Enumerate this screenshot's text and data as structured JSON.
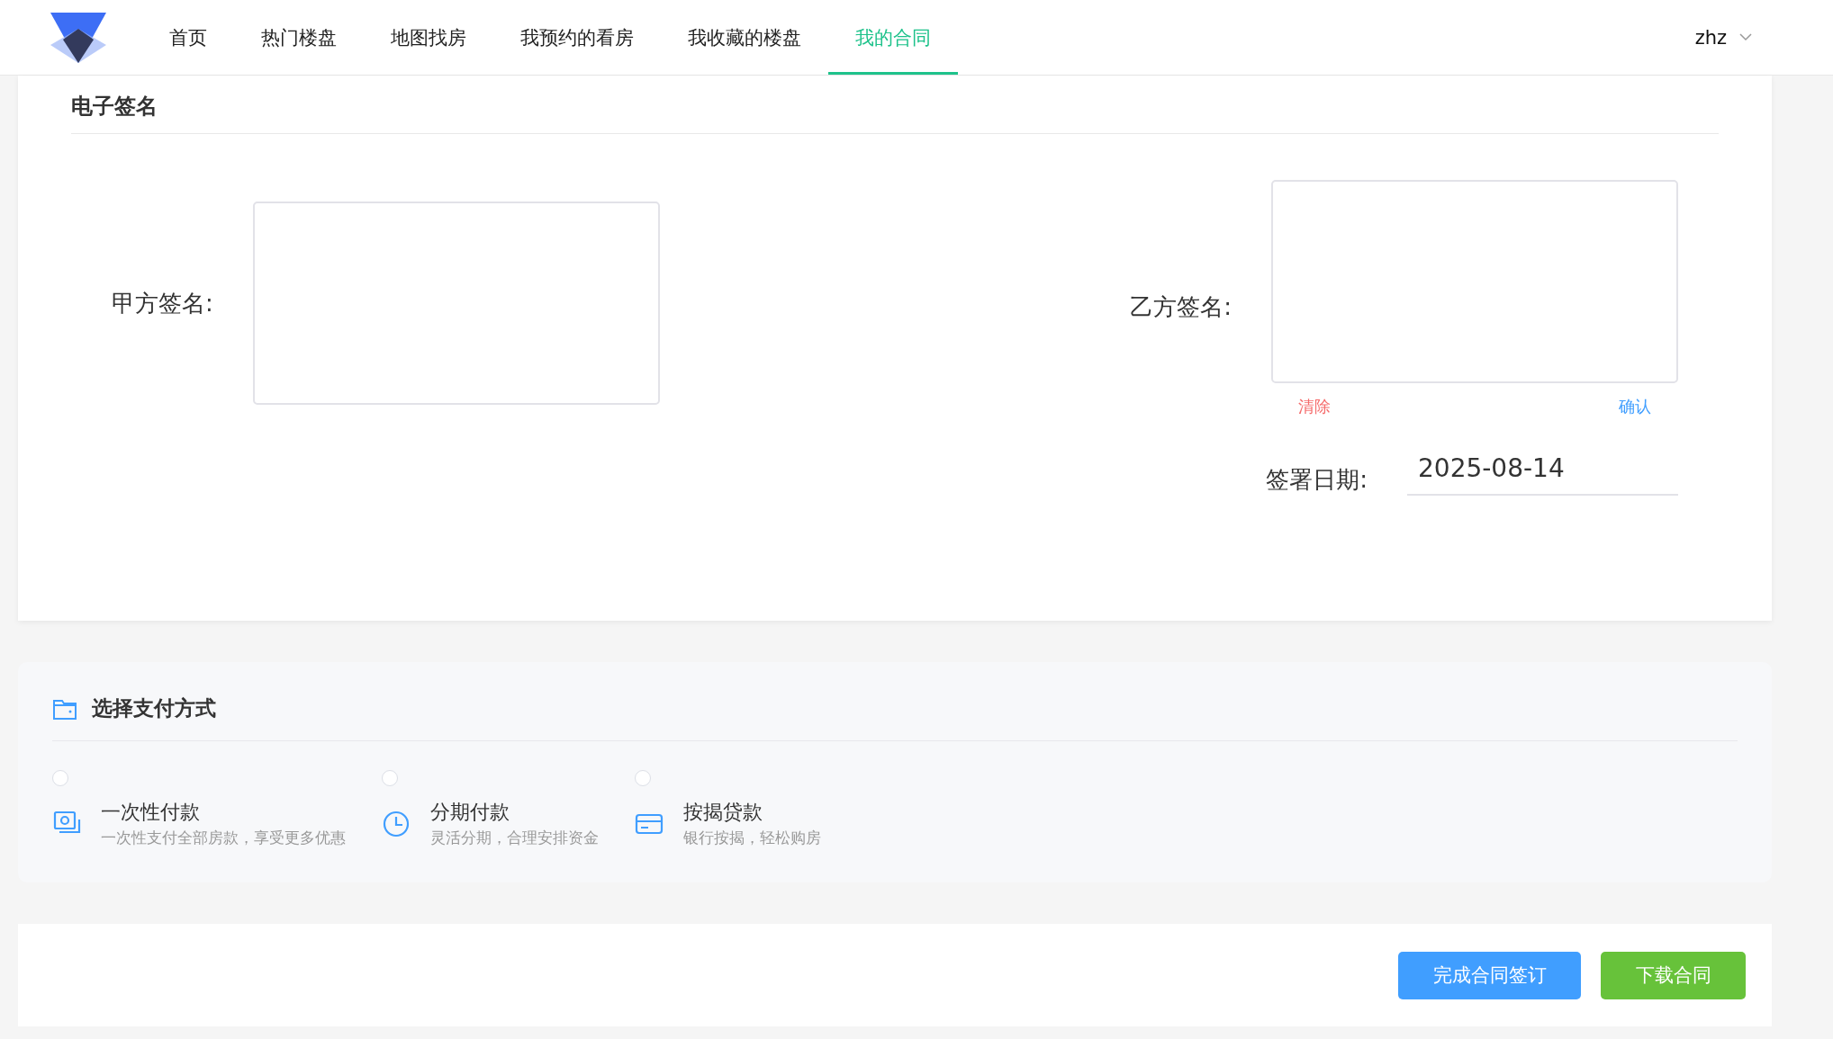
{
  "nav": {
    "items": [
      {
        "label": "首页",
        "selected": false
      },
      {
        "label": "热门楼盘",
        "selected": false
      },
      {
        "label": "地图找房",
        "selected": false
      },
      {
        "label": "我预约的看房",
        "selected": false
      },
      {
        "label": "我收藏的楼盘",
        "selected": false
      },
      {
        "label": "我的合同",
        "selected": true
      }
    ],
    "user": "zhz"
  },
  "signature": {
    "title": "电子签名",
    "party_a_label": "甲方签名:",
    "party_b_label": "乙方签名:",
    "clear": "清除",
    "confirm": "确认",
    "date_label": "签署日期:",
    "date_value": "2025-08-14"
  },
  "payment": {
    "title": "选择支付方式",
    "options": [
      {
        "kind": "cash",
        "title": "一次性付款",
        "desc": "一次性支付全部房款，享受更多优惠",
        "selected": false
      },
      {
        "kind": "clock",
        "title": "分期付款",
        "desc": "灵活分期，合理安排资金",
        "selected": false
      },
      {
        "kind": "card",
        "title": "按揭贷款",
        "desc": "银行按揭，轻松购房",
        "selected": false
      }
    ]
  },
  "actions": [
    {
      "kind": "primary",
      "label": "完成合同签订"
    },
    {
      "kind": "success",
      "label": "下载合同"
    }
  ]
}
